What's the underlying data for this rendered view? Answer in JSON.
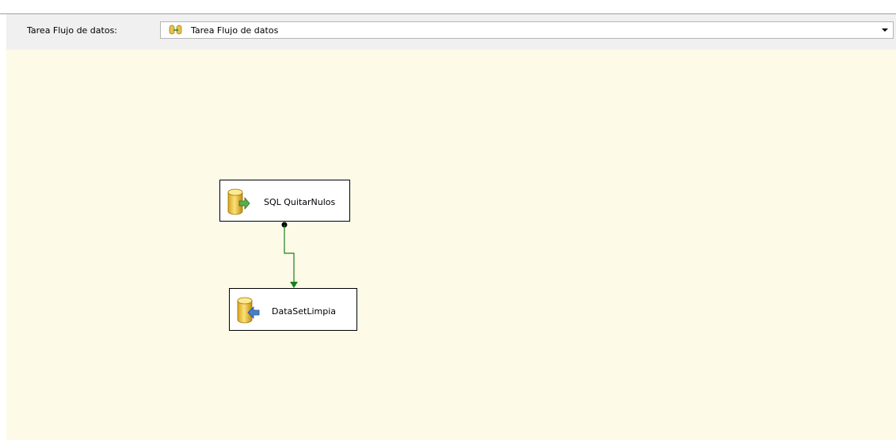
{
  "toolbar": {
    "label": "Tarea Flujo de datos:",
    "selected_task": "Tarea Flujo de datos",
    "selected_task_icon": "data-flow-task-icon"
  },
  "canvas": {
    "background": "#fdfbe8",
    "nodes": [
      {
        "label": "SQL QuitarNulos",
        "icon": "ole-db-source-icon"
      },
      {
        "label": "DataSetLimpia",
        "icon": "ole-db-destination-icon"
      }
    ],
    "path_color": "#1a7f1a"
  }
}
